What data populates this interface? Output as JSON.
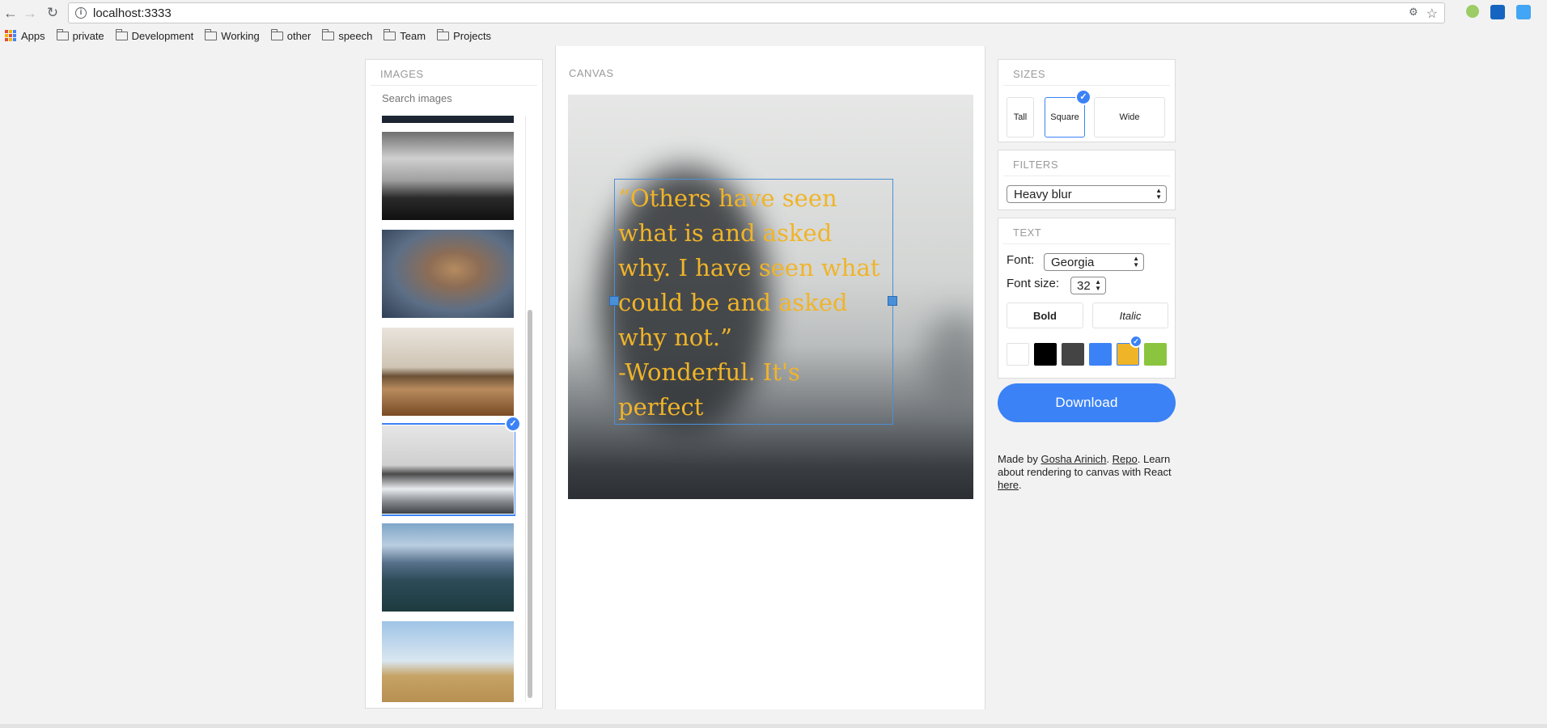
{
  "browser": {
    "url": "localhost:3333",
    "bookmarks": [
      "Apps",
      "private",
      "Development",
      "Working",
      "other",
      "speech",
      "Team",
      "Projects"
    ]
  },
  "images_panel": {
    "title": "IMAGES",
    "search_placeholder": "Search images"
  },
  "canvas_panel": {
    "title": "CANVAS",
    "quote_lines": [
      "“Others have seen",
      "what is and asked",
      "why. I have seen what",
      "could be and asked",
      "why not.”",
      "-Wonderful. It's",
      "perfect"
    ]
  },
  "sizes": {
    "title": "SIZES",
    "options": [
      "Tall",
      "Square",
      "Wide"
    ],
    "selected": "Square"
  },
  "filters": {
    "title": "FILTERS",
    "selected": "Heavy blur"
  },
  "text": {
    "title": "TEXT",
    "font_label": "Font:",
    "font_value": "Georgia",
    "size_label": "Font size:",
    "size_value": "32",
    "bold_label": "Bold",
    "italic_label": "Italic",
    "colors": [
      "#ffffff",
      "#000000",
      "#444444",
      "#3b82f6",
      "#f0b429",
      "#8bc53f"
    ],
    "selected_color": "#f0b429"
  },
  "download_label": "Download",
  "credits": {
    "made_by": "Made by ",
    "author": "Gosha Arinich",
    "sep": ". ",
    "repo": "Repo",
    "line2": ". Learn about rendering to canvas with React ",
    "here": "here",
    "end": "."
  }
}
